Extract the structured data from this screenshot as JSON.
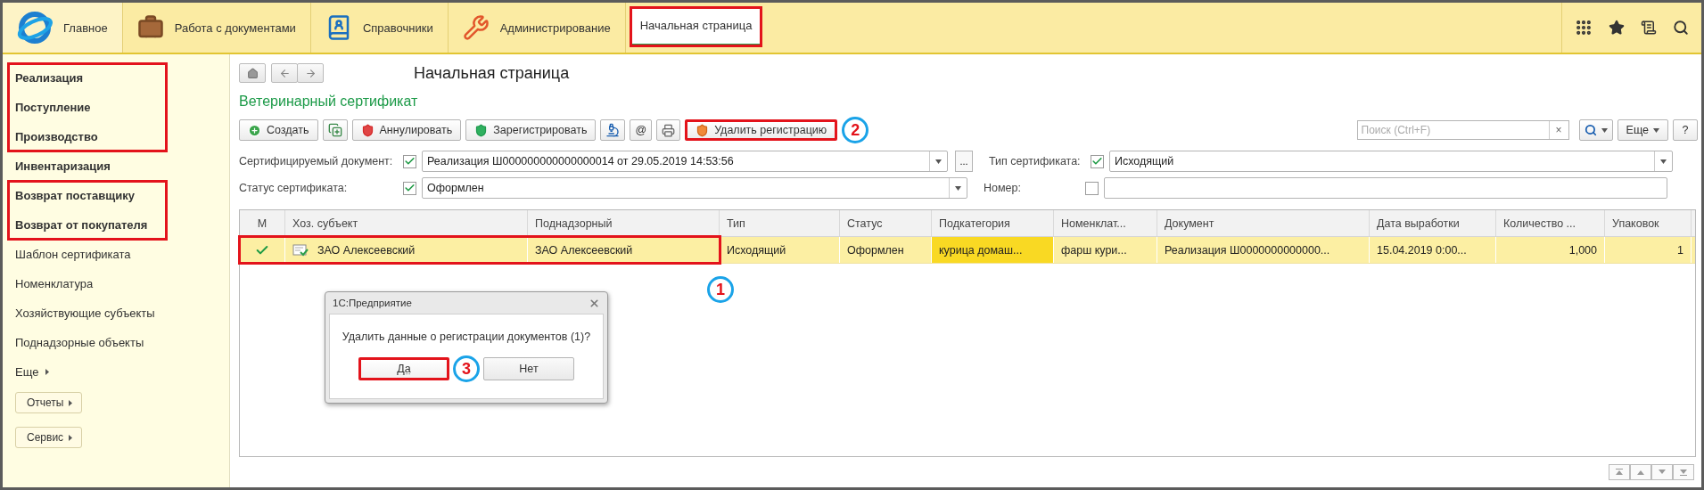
{
  "top_bar": {
    "sections": [
      {
        "label": "Главное",
        "kind": "logo",
        "selected": true
      },
      {
        "label": "Работа с документами",
        "kind": "briefcase",
        "selected": false
      },
      {
        "label": "Справочники",
        "kind": "directory",
        "selected": false
      },
      {
        "label": "Администрирование",
        "kind": "tools",
        "selected": false
      }
    ],
    "tabs": [
      {
        "label": "Начальная страница",
        "selected": true,
        "highlighted": true
      }
    ]
  },
  "sidebar": {
    "groups": [
      {
        "highlighted": true,
        "items": [
          {
            "label": "Реализация",
            "kind": "document"
          },
          {
            "label": "Поступление",
            "kind": "document"
          },
          {
            "label": "Производство",
            "kind": "document"
          }
        ]
      },
      {
        "highlighted": false,
        "items": [
          {
            "label": "Инвентаризация",
            "kind": "document"
          }
        ]
      },
      {
        "highlighted": true,
        "items": [
          {
            "label": "Возврат поставщику",
            "kind": "document"
          },
          {
            "label": "Возврат от покупателя",
            "kind": "document"
          }
        ]
      },
      {
        "highlighted": false,
        "items": [
          {
            "label": "Шаблон сертификата",
            "kind": "catalog"
          },
          {
            "label": "Номенклатура",
            "kind": "catalog"
          },
          {
            "label": "Хозяйствующие субъекты",
            "kind": "catalog"
          },
          {
            "label": "Поднадзорные объекты",
            "kind": "catalog"
          }
        ]
      }
    ],
    "more": "Еще",
    "buttons": [
      "Отчеты",
      "Сервис"
    ]
  },
  "page_title": "Начальная страница",
  "form_title": "Ветеринарный сертификат",
  "toolbar": [
    {
      "kind": "create",
      "label": "Создать",
      "highlighted": false
    },
    {
      "kind": "copy",
      "highlighted": false
    },
    {
      "kind": "annul",
      "label": "Аннулировать",
      "highlighted": false
    },
    {
      "kind": "register",
      "label": "Зарегистрировать",
      "highlighted": false
    },
    {
      "kind": "microscope",
      "highlighted": false
    },
    {
      "kind": "text",
      "label": "@",
      "highlighted": false
    },
    {
      "kind": "print",
      "highlighted": false
    },
    {
      "kind": "unregister",
      "label": "Удалить регистрацию",
      "highlighted": true,
      "callout": "2"
    }
  ],
  "search": {
    "placeholder": "Поиск (Ctrl+F)",
    "clear": "×"
  },
  "more_button": "Еще",
  "help_button": "?",
  "filters": [
    [
      {
        "label": "Сертифицируемый документ:",
        "checked": true,
        "kind": "choice",
        "value": "Реализация Ш000000000000000014 от 29.05.2019 14:53:56",
        "extra": "..."
      },
      {
        "label": "Тип сертификата:",
        "checked": true,
        "kind": "select",
        "value": "Исходящий"
      }
    ],
    [
      {
        "label": "Статус сертификата:",
        "checked": true,
        "kind": "select",
        "value": "Оформлен"
      },
      {
        "label": "Номер:",
        "checked": false,
        "kind": "text"
      }
    ]
  ],
  "table": {
    "columns": [
      "М",
      "Хоз. субъект",
      "Поднадзорный",
      "Тип",
      "Статус",
      "Подкатегория",
      "Номенклат...",
      "Документ",
      "Дата выработки",
      "Количество ...",
      "Упаковок"
    ],
    "rows": [
      {
        "selected": true,
        "highlighted": true,
        "callout": "1",
        "cells": [
          {
            "text": "",
            "marked": true,
            "current": false
          },
          {
            "text": "ЗАО  Алексеевский",
            "current": false
          },
          {
            "text": "ЗАО Алексеевский",
            "current": false
          },
          {
            "text": "Исходящий",
            "current": false
          },
          {
            "text": "Оформлен",
            "current": false
          },
          {
            "text": "курица домаш...",
            "current": true
          },
          {
            "text": "фарш кури...",
            "current": false
          },
          {
            "text": "Реализация Ш0000000000000...",
            "current": false
          },
          {
            "text": "15.04.2019 0:00...",
            "current": false
          },
          {
            "text": "1,000",
            "current": false
          },
          {
            "text": "1",
            "current": false
          }
        ]
      }
    ]
  },
  "dialog": {
    "title": "1С:Предприятие",
    "message": "Удалить данные о регистрации документов (1)?",
    "buttons": [
      {
        "label": "Да",
        "default": true,
        "highlighted": true,
        "callout": "3"
      },
      {
        "label": "Нет",
        "default": false,
        "highlighted": false
      }
    ]
  }
}
